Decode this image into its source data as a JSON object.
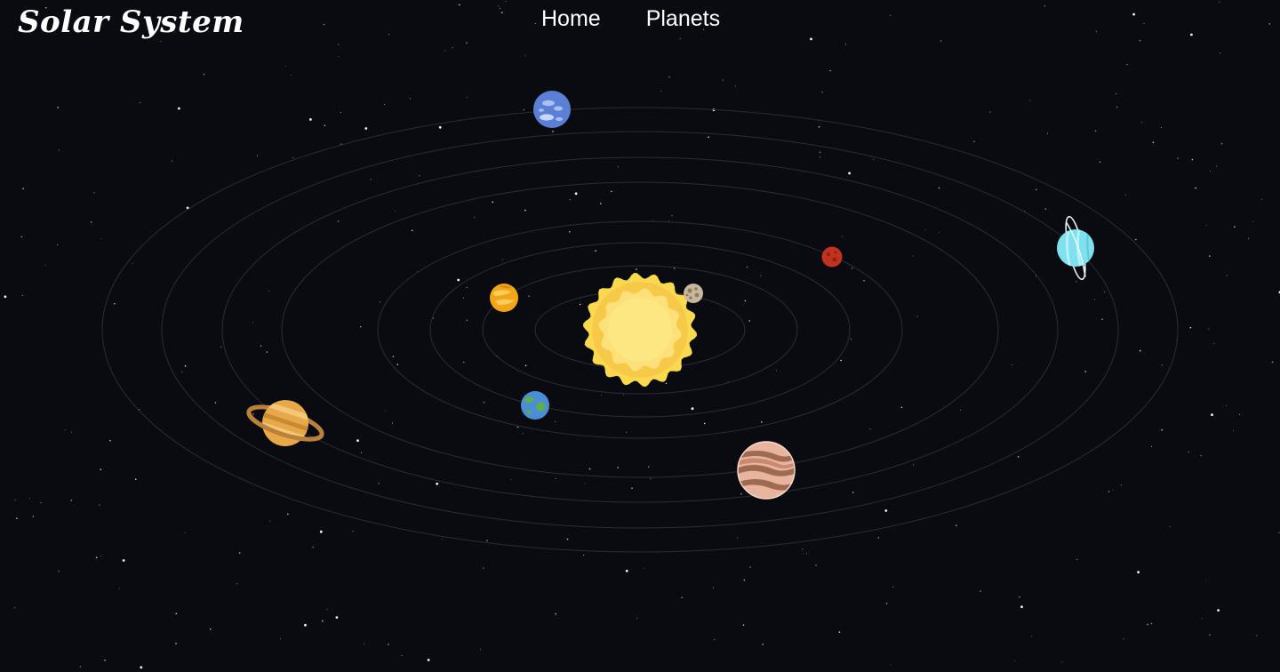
{
  "header": {
    "brand": "Solar System",
    "nav": [
      {
        "label": "Home"
      },
      {
        "label": "Planets"
      }
    ]
  },
  "colors": {
    "background": "#0a0b10",
    "orbit": "#2a2d33",
    "sun_outer": "#fbd94f",
    "sun_inner": "#fde783",
    "mercury": "#b9a58a",
    "venus": "#f2a516",
    "earth": "#4a8fd6",
    "mars": "#c0321f",
    "jupiter": "#e9b49e",
    "saturn": "#e7a84a",
    "uranus": "#7fe0ee",
    "neptune": "#5b7fd4"
  },
  "icons": [
    "sun-icon",
    "mercury-icon",
    "venus-icon",
    "earth-icon",
    "mars-icon",
    "jupiter-icon",
    "saturn-icon",
    "uranus-icon",
    "neptune-icon"
  ]
}
